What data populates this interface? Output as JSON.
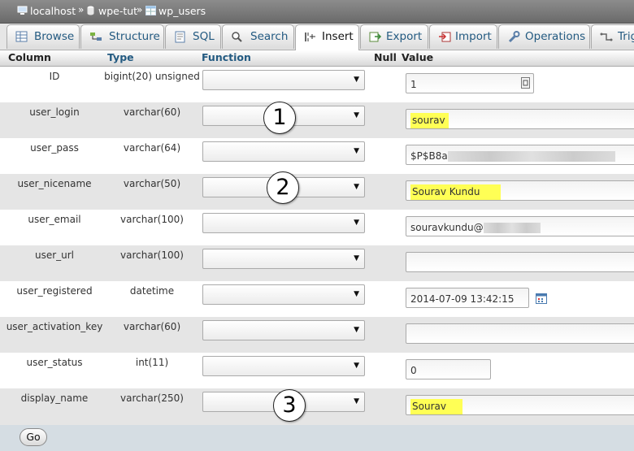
{
  "breadcrumb": {
    "items": [
      "localhost",
      "wpe-tut",
      "wp_users"
    ],
    "separator": "»"
  },
  "tabs": [
    {
      "label": "Browse",
      "icon": "browse-icon",
      "active": false
    },
    {
      "label": "Structure",
      "icon": "structure-icon",
      "active": false
    },
    {
      "label": "SQL",
      "icon": "sql-icon",
      "active": false
    },
    {
      "label": "Search",
      "icon": "search-icon",
      "active": false
    },
    {
      "label": "Insert",
      "icon": "insert-icon",
      "active": true
    },
    {
      "label": "Export",
      "icon": "export-icon",
      "active": false
    },
    {
      "label": "Import",
      "icon": "import-icon",
      "active": false
    },
    {
      "label": "Operations",
      "icon": "wrench-icon",
      "active": false
    },
    {
      "label": "Trig",
      "icon": "triggers-icon",
      "active": false
    }
  ],
  "table_header": {
    "column": "Column",
    "type": "Type",
    "function": "Function",
    "null": "Null",
    "value": "Value"
  },
  "rows": [
    {
      "column": "ID",
      "type": "bigint(20) unsigned",
      "value": "1",
      "highlight": false
    },
    {
      "column": "user_login",
      "type": "varchar(60)",
      "value": "sourav",
      "highlight": true
    },
    {
      "column": "user_pass",
      "type": "varchar(64)",
      "value": "$P$B8a",
      "highlight": false,
      "redacted": true
    },
    {
      "column": "user_nicename",
      "type": "varchar(50)",
      "value": "Sourav Kundu",
      "highlight": true
    },
    {
      "column": "user_email",
      "type": "varchar(100)",
      "value": "souravkundu@",
      "highlight": false,
      "redacted": true
    },
    {
      "column": "user_url",
      "type": "varchar(100)",
      "value": "",
      "highlight": false
    },
    {
      "column": "user_registered",
      "type": "datetime",
      "value": "2014-07-09 13:42:15",
      "highlight": false
    },
    {
      "column": "user_activation_key",
      "type": "varchar(60)",
      "value": "",
      "highlight": false
    },
    {
      "column": "user_status",
      "type": "int(11)",
      "value": "0",
      "highlight": false
    },
    {
      "column": "display_name",
      "type": "varchar(250)",
      "value": "Sourav",
      "highlight": true
    }
  ],
  "annotations": [
    "1",
    "2",
    "3"
  ],
  "footer": {
    "go_label": "Go"
  },
  "colors": {
    "highlight": "#ffff55",
    "link": "#235a81",
    "footer_bg": "#d5dde3",
    "row_alt": "#e5e5e5"
  }
}
